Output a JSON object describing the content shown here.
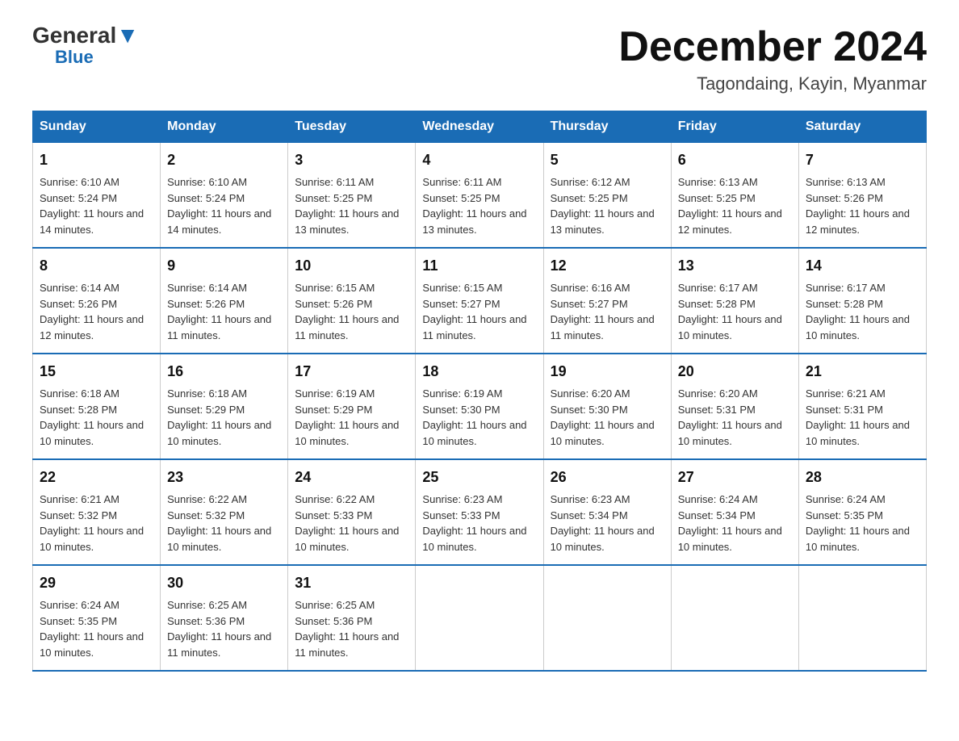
{
  "header": {
    "logo_general": "General",
    "logo_blue": "Blue",
    "month_title": "December 2024",
    "subtitle": "Tagondaing, Kayin, Myanmar"
  },
  "days_of_week": [
    "Sunday",
    "Monday",
    "Tuesday",
    "Wednesday",
    "Thursday",
    "Friday",
    "Saturday"
  ],
  "weeks": [
    [
      {
        "day": "1",
        "sunrise": "6:10 AM",
        "sunset": "5:24 PM",
        "daylight": "11 hours and 14 minutes."
      },
      {
        "day": "2",
        "sunrise": "6:10 AM",
        "sunset": "5:24 PM",
        "daylight": "11 hours and 14 minutes."
      },
      {
        "day": "3",
        "sunrise": "6:11 AM",
        "sunset": "5:25 PM",
        "daylight": "11 hours and 13 minutes."
      },
      {
        "day": "4",
        "sunrise": "6:11 AM",
        "sunset": "5:25 PM",
        "daylight": "11 hours and 13 minutes."
      },
      {
        "day": "5",
        "sunrise": "6:12 AM",
        "sunset": "5:25 PM",
        "daylight": "11 hours and 13 minutes."
      },
      {
        "day": "6",
        "sunrise": "6:13 AM",
        "sunset": "5:25 PM",
        "daylight": "11 hours and 12 minutes."
      },
      {
        "day": "7",
        "sunrise": "6:13 AM",
        "sunset": "5:26 PM",
        "daylight": "11 hours and 12 minutes."
      }
    ],
    [
      {
        "day": "8",
        "sunrise": "6:14 AM",
        "sunset": "5:26 PM",
        "daylight": "11 hours and 12 minutes."
      },
      {
        "day": "9",
        "sunrise": "6:14 AM",
        "sunset": "5:26 PM",
        "daylight": "11 hours and 11 minutes."
      },
      {
        "day": "10",
        "sunrise": "6:15 AM",
        "sunset": "5:26 PM",
        "daylight": "11 hours and 11 minutes."
      },
      {
        "day": "11",
        "sunrise": "6:15 AM",
        "sunset": "5:27 PM",
        "daylight": "11 hours and 11 minutes."
      },
      {
        "day": "12",
        "sunrise": "6:16 AM",
        "sunset": "5:27 PM",
        "daylight": "11 hours and 11 minutes."
      },
      {
        "day": "13",
        "sunrise": "6:17 AM",
        "sunset": "5:28 PM",
        "daylight": "11 hours and 10 minutes."
      },
      {
        "day": "14",
        "sunrise": "6:17 AM",
        "sunset": "5:28 PM",
        "daylight": "11 hours and 10 minutes."
      }
    ],
    [
      {
        "day": "15",
        "sunrise": "6:18 AM",
        "sunset": "5:28 PM",
        "daylight": "11 hours and 10 minutes."
      },
      {
        "day": "16",
        "sunrise": "6:18 AM",
        "sunset": "5:29 PM",
        "daylight": "11 hours and 10 minutes."
      },
      {
        "day": "17",
        "sunrise": "6:19 AM",
        "sunset": "5:29 PM",
        "daylight": "11 hours and 10 minutes."
      },
      {
        "day": "18",
        "sunrise": "6:19 AM",
        "sunset": "5:30 PM",
        "daylight": "11 hours and 10 minutes."
      },
      {
        "day": "19",
        "sunrise": "6:20 AM",
        "sunset": "5:30 PM",
        "daylight": "11 hours and 10 minutes."
      },
      {
        "day": "20",
        "sunrise": "6:20 AM",
        "sunset": "5:31 PM",
        "daylight": "11 hours and 10 minutes."
      },
      {
        "day": "21",
        "sunrise": "6:21 AM",
        "sunset": "5:31 PM",
        "daylight": "11 hours and 10 minutes."
      }
    ],
    [
      {
        "day": "22",
        "sunrise": "6:21 AM",
        "sunset": "5:32 PM",
        "daylight": "11 hours and 10 minutes."
      },
      {
        "day": "23",
        "sunrise": "6:22 AM",
        "sunset": "5:32 PM",
        "daylight": "11 hours and 10 minutes."
      },
      {
        "day": "24",
        "sunrise": "6:22 AM",
        "sunset": "5:33 PM",
        "daylight": "11 hours and 10 minutes."
      },
      {
        "day": "25",
        "sunrise": "6:23 AM",
        "sunset": "5:33 PM",
        "daylight": "11 hours and 10 minutes."
      },
      {
        "day": "26",
        "sunrise": "6:23 AM",
        "sunset": "5:34 PM",
        "daylight": "11 hours and 10 minutes."
      },
      {
        "day": "27",
        "sunrise": "6:24 AM",
        "sunset": "5:34 PM",
        "daylight": "11 hours and 10 minutes."
      },
      {
        "day": "28",
        "sunrise": "6:24 AM",
        "sunset": "5:35 PM",
        "daylight": "11 hours and 10 minutes."
      }
    ],
    [
      {
        "day": "29",
        "sunrise": "6:24 AM",
        "sunset": "5:35 PM",
        "daylight": "11 hours and 10 minutes."
      },
      {
        "day": "30",
        "sunrise": "6:25 AM",
        "sunset": "5:36 PM",
        "daylight": "11 hours and 11 minutes."
      },
      {
        "day": "31",
        "sunrise": "6:25 AM",
        "sunset": "5:36 PM",
        "daylight": "11 hours and 11 minutes."
      },
      null,
      null,
      null,
      null
    ]
  ]
}
